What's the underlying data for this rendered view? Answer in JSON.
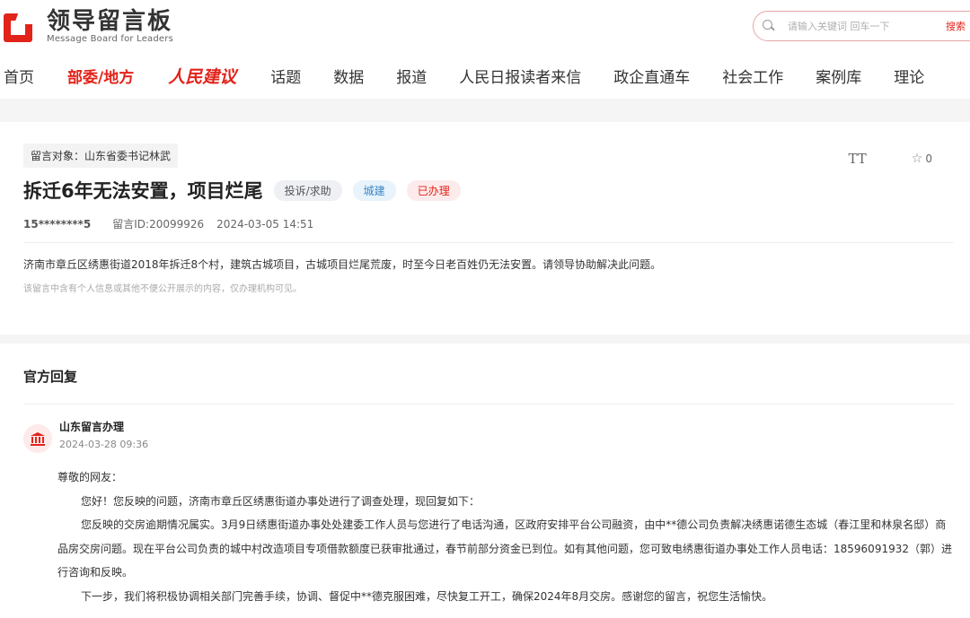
{
  "brand": {
    "name_cn": "领导留言板",
    "name_en": "Message Board for Leaders",
    "accent": "#e2231a"
  },
  "search": {
    "placeholder": "请输入关键词 回车一下",
    "button": "搜索"
  },
  "nav": {
    "items": [
      "首页",
      "部委/地方",
      "人民建议",
      "话题",
      "数据",
      "报道",
      "人民日报读者来信",
      "政企直通车",
      "社会工作",
      "案例库",
      "理论"
    ],
    "active_index": 1
  },
  "message": {
    "target": "留言对象：山东省委书记林武",
    "font_tool": "TT",
    "favorites": "0",
    "title": "拆迁6年无法安置，项目烂尾",
    "tags": [
      "投诉/求助",
      "城建",
      "已办理"
    ],
    "user": "15********5",
    "message_id": "留言ID:20099926",
    "time": "2024-03-05 14:51",
    "content": "济南市章丘区绣惠街道2018年拆迁8个村，建筑古城项目，古城项目烂尾荒废，时至今日老百姓仍无法安置。请领导协助解决此问题。",
    "privacy_note": "该留言中含有个人信息或其他不便公开展示的内容，仅办理机构可见。"
  },
  "reply": {
    "heading": "官方回复",
    "replier": "山东留言办理",
    "time": "2024-03-28 09:36",
    "greeting": "尊敬的网友：",
    "paragraphs": [
      "您好！您反映的问题，济南市章丘区绣惠街道办事处进行了调查处理，现回复如下：",
      "您反映的交房逾期情况属实。3月9日绣惠街道办事处处建委工作人员与您进行了电话沟通，区政府安排平台公司融资，由中**德公司负责解决绣惠诺德生态城（春江里和林泉名邸）商品房交房问题。现在平台公司负责的城中村改造项目专项借款额度已获审批通过，春节前部分资金已到位。如有其他问题，您可致电绣惠街道办事处工作人员电话：18596091932（郭）进行咨询和反映。",
      "下一步，我们将积极协调相关部门完善手续，协调、督促中**德克服困难，尽快复工开工，确保2024年8月交房。感谢您的留言，祝您生活愉快。"
    ]
  }
}
